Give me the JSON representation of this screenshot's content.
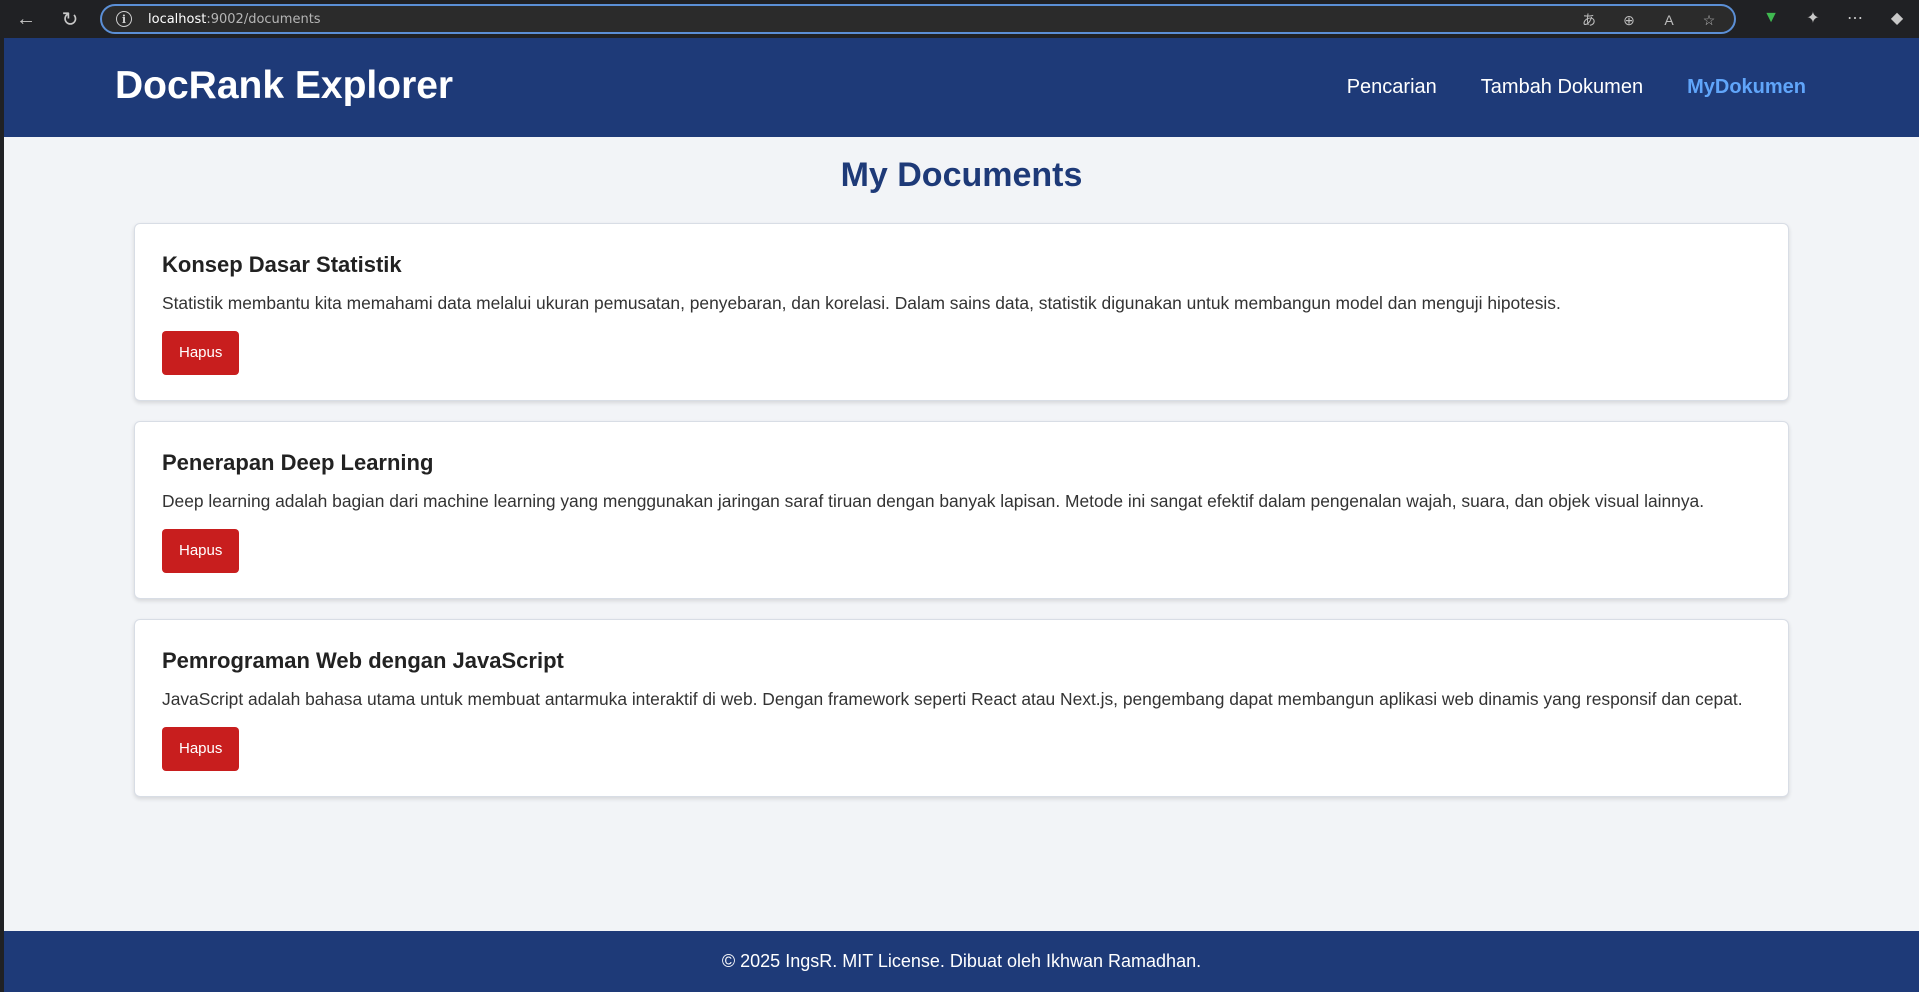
{
  "browser": {
    "url_host": "localhost",
    "url_rest": ":9002/documents"
  },
  "header": {
    "brand": "DocRank Explorer",
    "nav": [
      {
        "label": "Pencarian",
        "active": false
      },
      {
        "label": "Tambah Dokumen",
        "active": false
      },
      {
        "label": "MyDokumen",
        "active": true
      }
    ]
  },
  "main": {
    "title": "My Documents",
    "documents": [
      {
        "title": "Konsep Dasar Statistik",
        "body": "Statistik membantu kita memahami data melalui ukuran pemusatan, penyebaran, dan korelasi. Dalam sains data, statistik digunakan untuk membangun model dan menguji hipotesis.",
        "delete_label": "Hapus"
      },
      {
        "title": "Penerapan Deep Learning",
        "body": "Deep learning adalah bagian dari machine learning yang menggunakan jaringan saraf tiruan dengan banyak lapisan. Metode ini sangat efektif dalam pengenalan wajah, suara, dan objek visual lainnya.",
        "delete_label": "Hapus"
      },
      {
        "title": "Pemrograman Web dengan JavaScript",
        "body": "JavaScript adalah bahasa utama untuk membuat antarmuka interaktif di web. Dengan framework seperti React atau Next.js, pengembang dapat membangun aplikasi web dinamis yang responsif dan cepat.",
        "delete_label": "Hapus"
      }
    ]
  },
  "footer": {
    "text": "© 2025 IngsR. MIT License. Dibuat oleh Ikhwan Ramadhan."
  },
  "colors": {
    "header_bg": "#1e3a78",
    "nav_active": "#60a5fa",
    "delete_button": "#c81e1e",
    "page_bg": "#f2f4f7"
  }
}
